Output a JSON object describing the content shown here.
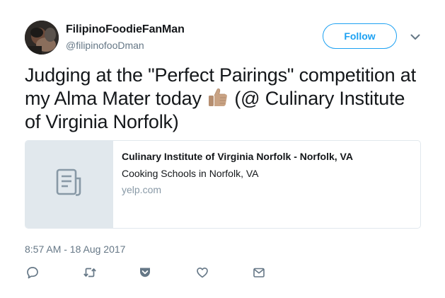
{
  "user": {
    "name": "FilipinoFoodieFanMan",
    "handle": "@filipinofooDman"
  },
  "follow_label": "Follow",
  "tweet": {
    "text_before_emoji": "Judging at the \"Perfect Pairings\" competition at my Alma Mater today ",
    "emoji": "thumbs-up",
    "text_after_emoji": " (@ Culinary Institute of Virginia Norfolk)"
  },
  "card": {
    "title": "Culinary Institute of Virginia Norfolk - Norfolk, VA",
    "description": "Cooking Schools in Norfolk, VA",
    "domain": "yelp.com",
    "thumb_icon": "document-icon"
  },
  "timestamp": "8:57 AM - 18 Aug 2017",
  "actions": [
    "reply-icon",
    "retweet-icon",
    "pocket-icon",
    "like-icon",
    "direct-message-icon"
  ],
  "colors": {
    "accent": "#1da1f2",
    "secondary_text": "#657786",
    "icon": "#657786"
  }
}
